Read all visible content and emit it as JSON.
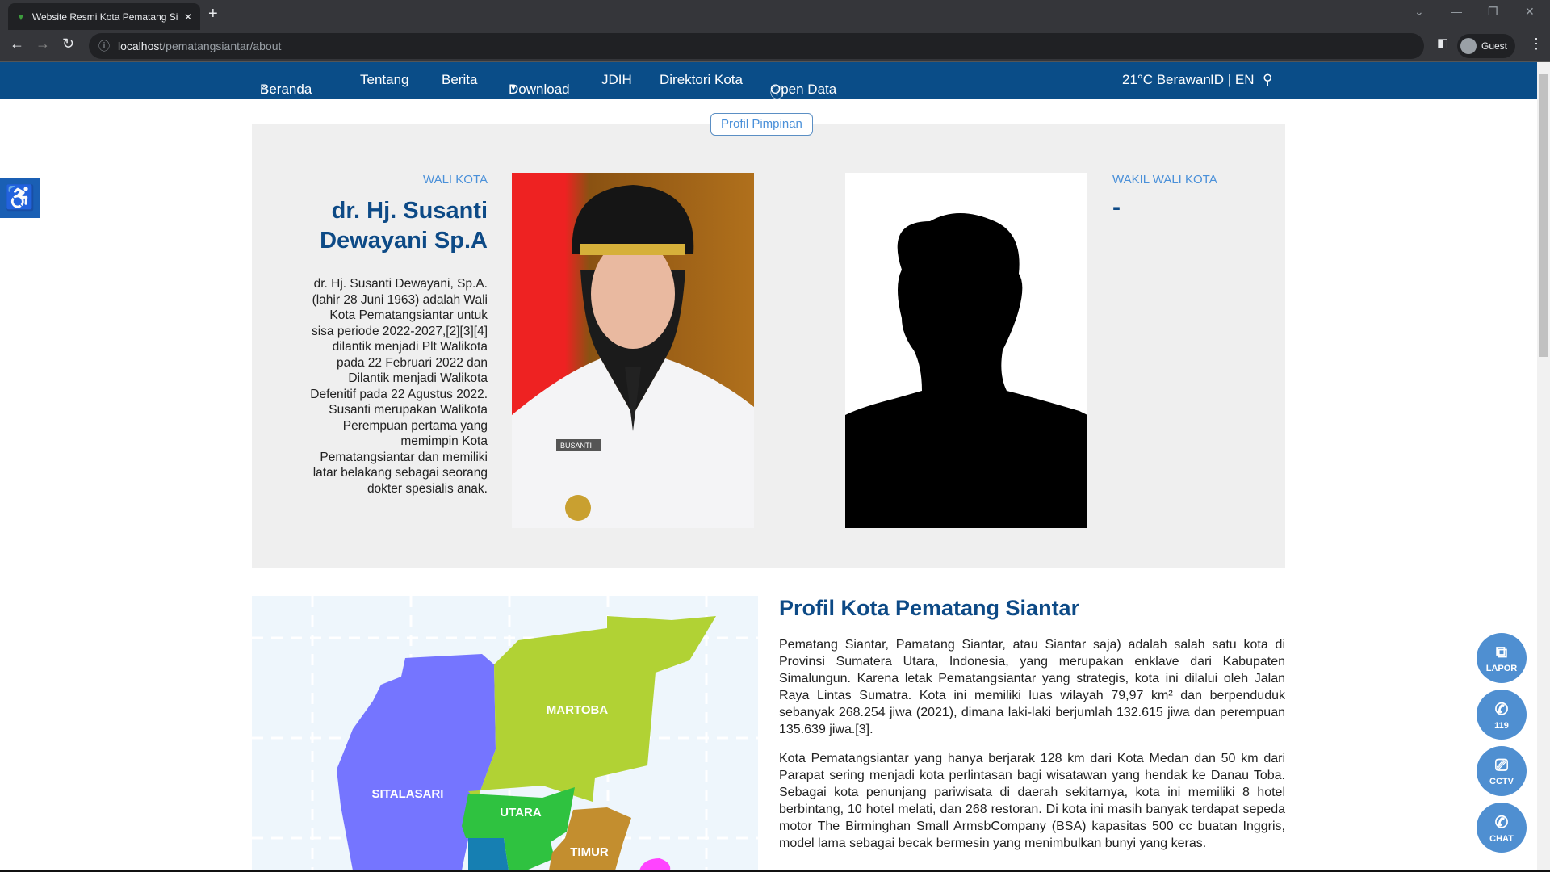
{
  "browser": {
    "tab_title": "Website Resmi Kota Pematang Siantar",
    "url_host": "localhost",
    "url_path": "/pematangsiantar/about",
    "profile": "Guest"
  },
  "nav": {
    "items": [
      "Beranda",
      "Tentang",
      "Berita",
      "Download",
      "JDIH",
      "Direktori Kota",
      "Open Data"
    ],
    "weather": "21°C Berawan",
    "lang": "ID | EN"
  },
  "leaders": {
    "section_label": "Profil Pimpinan",
    "mayor": {
      "role": "WALI KOTA",
      "name": "dr. Hj. Susanti Dewayani Sp.A",
      "bio": "dr. Hj. Susanti Dewayani, Sp.A. (lahir 28 Juni 1963) adalah Wali Kota Pematangsiantar untuk sisa periode 2022-2027,[2][3][4] dilantik menjadi Plt Walikota pada 22 Februari 2022 dan Dilantik menjadi Walikota Defenitif pada 22 Agustus 2022. Susanti merupakan Walikota Perempuan pertama yang memimpin Kota Pematangsiantar dan memiliki latar belakang sebagai seorang dokter spesialis anak.",
      "badge_name": "BUSANTI"
    },
    "vice": {
      "role": "WAKIL WALI KOTA",
      "name": "-"
    }
  },
  "map": {
    "districts": [
      "MARTOBA",
      "SITALASARI",
      "UTARA",
      "TIMUR"
    ]
  },
  "profile": {
    "title": "Profil Kota Pematang Siantar",
    "p1": "Pematang Siantar, Pamatang Siantar, atau Siantar saja) adalah salah satu kota di Provinsi Sumatera Utara, Indonesia, yang merupakan enklave dari Kabupaten Simalungun. Karena letak Pematangsiantar yang strategis, kota ini dilalui oleh Jalan Raya Lintas Sumatra. Kota ini memiliki luas wilayah 79,97 km² dan berpenduduk sebanyak 268.254 jiwa (2021), dimana laki-laki berjumlah 132.615 jiwa dan perempuan 135.639 jiwa.[3].",
    "p2": "Kota Pematangsiantar yang hanya berjarak 128 km dari Kota Medan dan 50 km dari Parapat sering menjadi kota perlintasan bagi wisatawan yang hendak ke Danau Toba. Sebagai kota penunjang pariwisata di daerah sekitarnya, kota ini memiliki 8 hotel berbintang, 10 hotel melati, dan 268 restoran. Di kota ini masih banyak terdapat sepeda motor The Birminghan Small ArmsbCompany (BSA) kapasitas 500 cc buatan Inggris, model lama sebagai becak bermesin yang menimbulkan bunyi yang keras."
  },
  "fabs": [
    "LAPOR",
    "119",
    "CCTV",
    "CHAT"
  ]
}
